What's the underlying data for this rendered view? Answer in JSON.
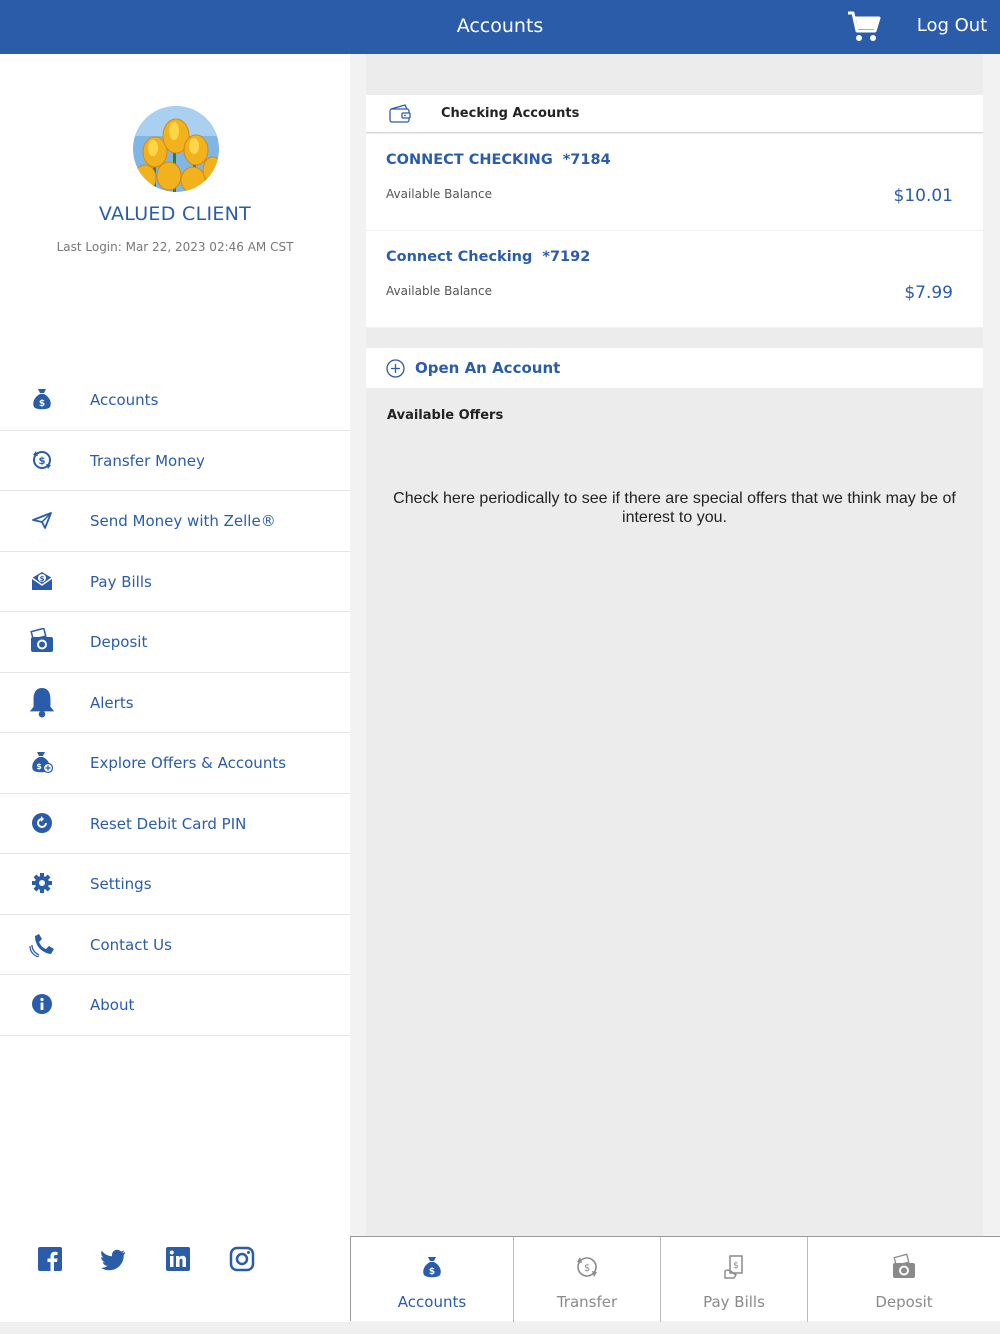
{
  "header": {
    "title": "Accounts",
    "logout_label": "Log Out",
    "cart_icon": "shopping-cart-icon"
  },
  "profile": {
    "name": "VALUED CLIENT",
    "last_login": "Last Login: Mar 22, 2023 02:46 AM CST"
  },
  "menu": {
    "items": [
      {
        "label": "Accounts",
        "icon": "money-bag-icon"
      },
      {
        "label": "Transfer Money",
        "icon": "transfer-icon"
      },
      {
        "label": "Send Money with Zelle®",
        "icon": "paper-plane-icon"
      },
      {
        "label": "Pay Bills",
        "icon": "envelope-dollar-icon"
      },
      {
        "label": "Deposit",
        "icon": "camera-check-icon"
      },
      {
        "label": "Alerts",
        "icon": "bell-icon"
      },
      {
        "label": "Explore Offers & Accounts",
        "icon": "money-bag-plus-icon"
      },
      {
        "label": "Reset Debit Card PIN",
        "icon": "reset-icon"
      },
      {
        "label": "Settings",
        "icon": "gear-icon"
      },
      {
        "label": "Contact Us",
        "icon": "phone-icon"
      },
      {
        "label": "About",
        "icon": "info-icon"
      }
    ]
  },
  "social": [
    "facebook-icon",
    "twitter-icon",
    "linkedin-icon",
    "instagram-icon"
  ],
  "accounts_section": {
    "title": "Checking Accounts",
    "accounts": [
      {
        "name": "CONNECT CHECKING",
        "number": "*7184",
        "balance_label": "Available Balance",
        "balance": "$10.01"
      },
      {
        "name": "Connect Checking",
        "number": "*7192",
        "balance_label": "Available Balance",
        "balance": "$7.99"
      }
    ]
  },
  "open_account_label": "Open An Account",
  "offers": {
    "title": "Available Offers",
    "message": "Check here periodically to see if there are special offers that we think may be of interest to you."
  },
  "tabs": [
    {
      "label": "Accounts",
      "icon": "money-bag-icon",
      "active": true
    },
    {
      "label": "Transfer",
      "icon": "transfer-icon",
      "active": false
    },
    {
      "label": "Pay Bills",
      "icon": "bill-icon",
      "active": false
    },
    {
      "label": "Deposit",
      "icon": "camera-check-icon",
      "active": false
    }
  ],
  "colors": {
    "brand": "#2a5caa",
    "background": "#ececec"
  }
}
